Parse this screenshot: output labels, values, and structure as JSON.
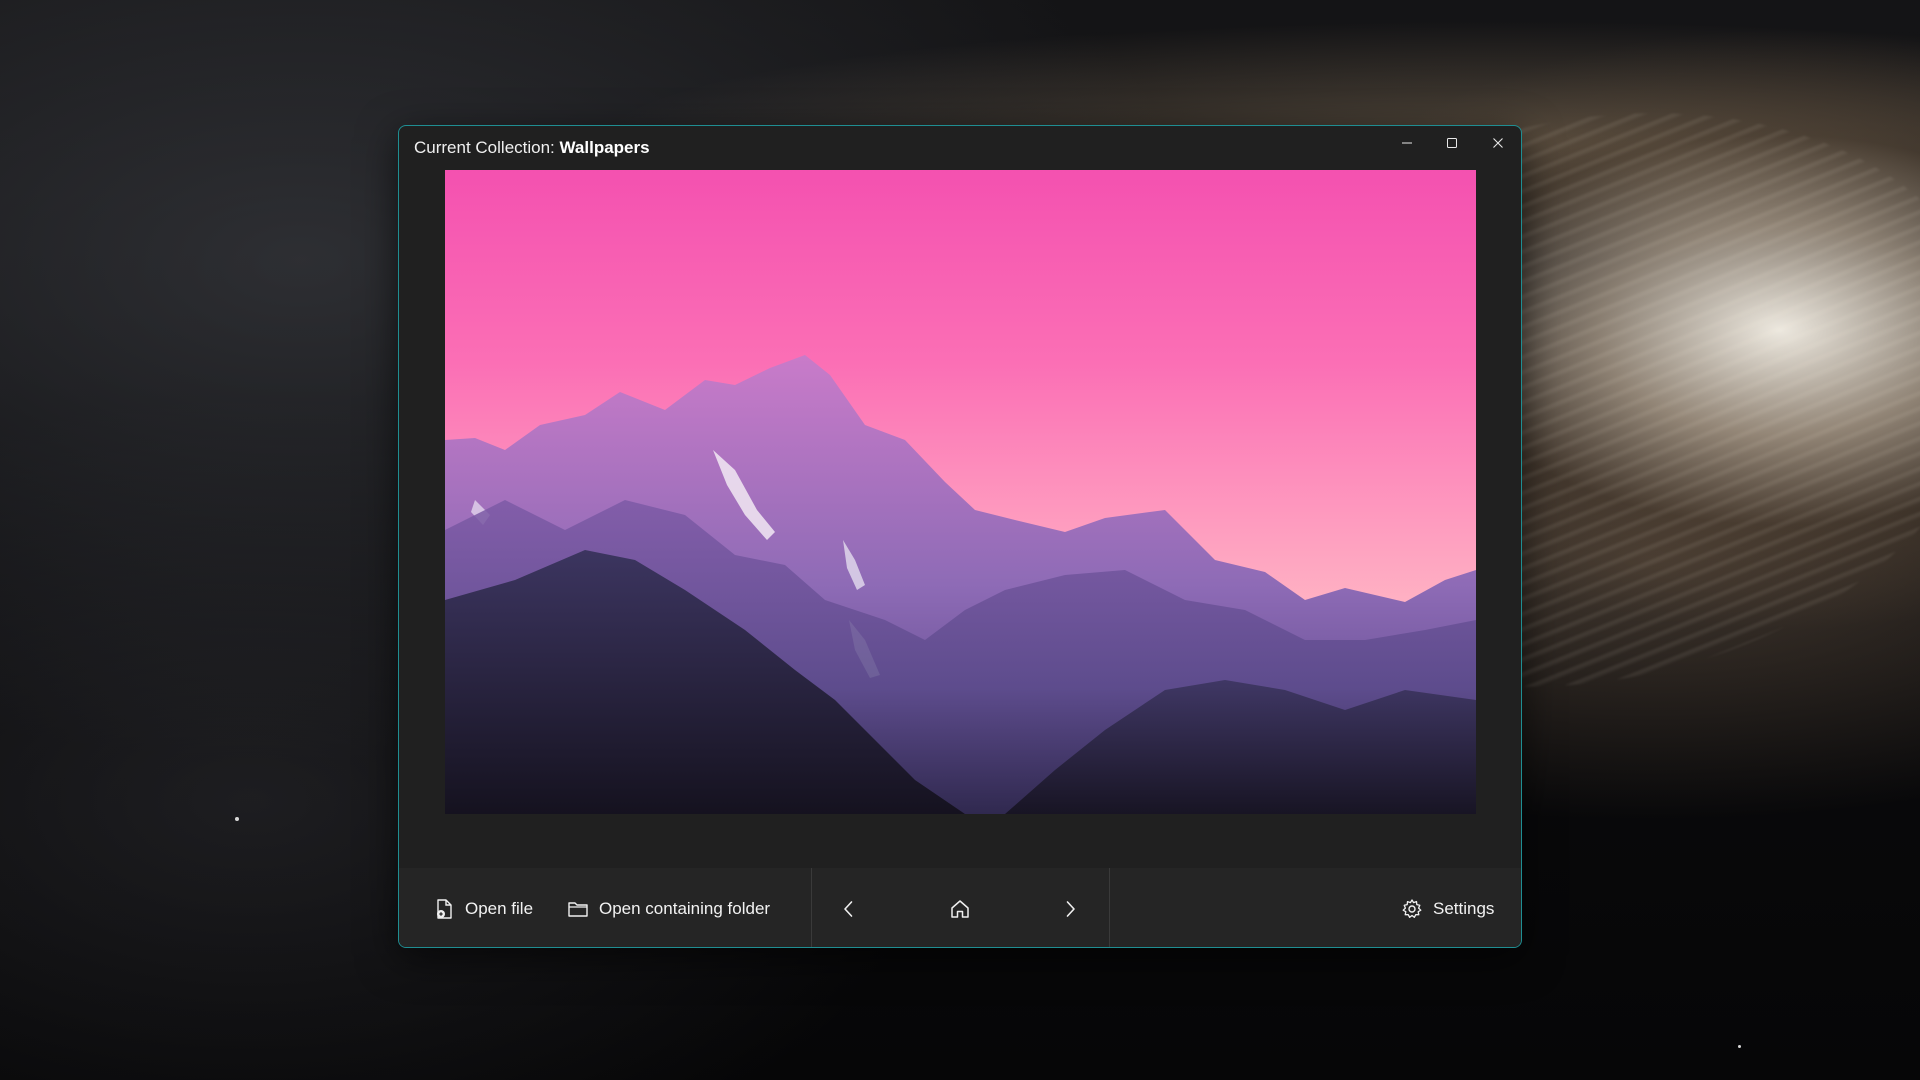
{
  "window": {
    "title_prefix": "Current Collection: ",
    "title_collection": "Wallpapers",
    "controls": {
      "minimize": "minimize-icon",
      "maximize": "maximize-icon",
      "close": "close-icon"
    },
    "border_color": "#1f8e92"
  },
  "toolbar": {
    "open_file_label": "Open file",
    "open_folder_label": "Open containing folder",
    "settings_label": "Settings",
    "icons": {
      "open_file": "open-file-icon",
      "open_folder": "folder-icon",
      "previous": "chevron-left-icon",
      "home": "home-icon",
      "next": "chevron-right-icon",
      "settings": "gear-icon"
    }
  },
  "colors": {
    "window_bg": "#202020",
    "toolbar_bg": "#252525",
    "sky_top": "#f451b0",
    "sky_bottom": "#ffb6c4"
  }
}
